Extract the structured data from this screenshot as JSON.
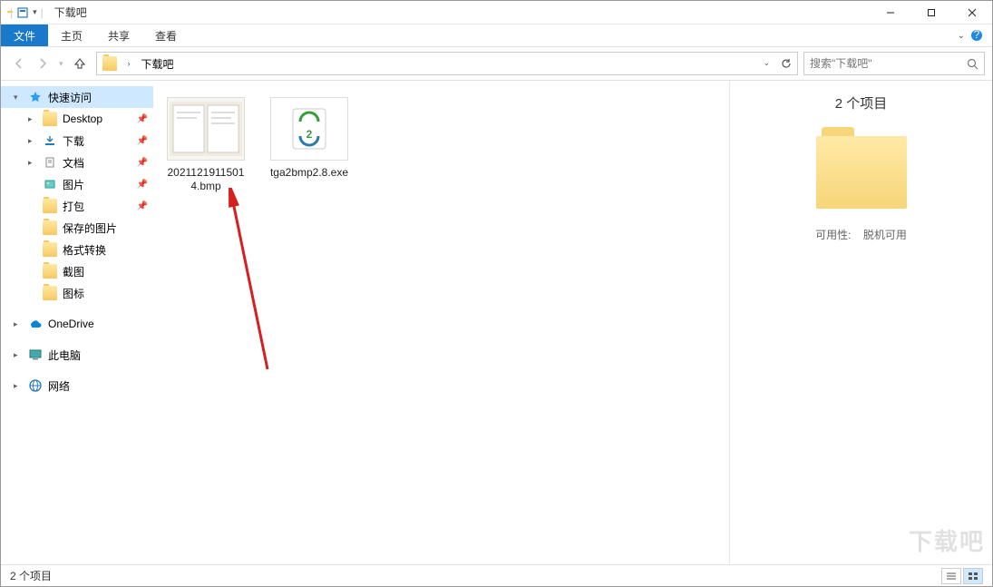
{
  "window": {
    "title": "下载吧",
    "min_tip": "最小化",
    "max_tip": "最大化",
    "close_tip": "关闭"
  },
  "ribbon": {
    "file": "文件",
    "tabs": [
      "主页",
      "共享",
      "查看"
    ]
  },
  "nav": {
    "path_root": "下载吧",
    "refresh_label": "刷新",
    "search_placeholder": "搜索\"下载吧\""
  },
  "sidebar": {
    "quick": {
      "label": "快速访问"
    },
    "items": [
      {
        "label": "Desktop",
        "pinned": true,
        "icon": "folder"
      },
      {
        "label": "下载",
        "pinned": true,
        "icon": "download"
      },
      {
        "label": "文档",
        "pinned": true,
        "icon": "document"
      },
      {
        "label": "图片",
        "pinned": true,
        "icon": "pictures"
      },
      {
        "label": "打包",
        "pinned": true,
        "icon": "folder"
      },
      {
        "label": "保存的图片",
        "pinned": false,
        "icon": "folder"
      },
      {
        "label": "格式转换",
        "pinned": false,
        "icon": "folder"
      },
      {
        "label": "截图",
        "pinned": false,
        "icon": "folder"
      },
      {
        "label": "图标",
        "pinned": false,
        "icon": "folder"
      }
    ],
    "onedrive": "OneDrive",
    "thispc": "此电脑",
    "network": "网络"
  },
  "files": [
    {
      "name": "20211219115014.bmp",
      "type": "bmp"
    },
    {
      "name": "tga2bmp2.8.exe",
      "type": "exe"
    }
  ],
  "preview": {
    "count_label": "2 个项目",
    "availability_key": "可用性:",
    "availability_val": "脱机可用"
  },
  "status": {
    "left": "2 个项目"
  },
  "watermark": "下载吧"
}
